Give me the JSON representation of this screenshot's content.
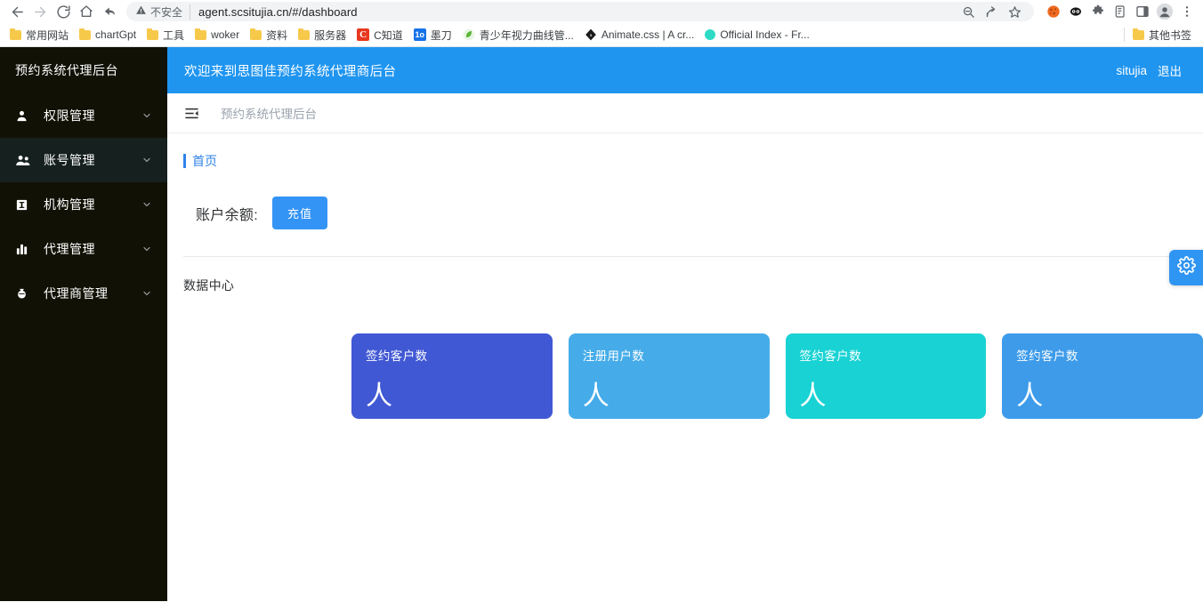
{
  "browser": {
    "nav": {
      "back": "back-arrow",
      "forward": "forward-arrow",
      "reload": "reload",
      "home": "home",
      "undo": "undo-arrow"
    },
    "omnibox": {
      "security_label": "不安全",
      "url": "agent.scsitujia.cn/#/dashboard",
      "zoom_icon": "zoom-out-icon",
      "share_icon": "share-icon",
      "bookmark_icon": "star-icon"
    },
    "extensions": [
      "cookie-icon",
      "panda-icon",
      "puzzle-icon",
      "reader-icon",
      "sidepanel-icon",
      "profile-icon",
      "menu-icon"
    ],
    "bookmarks": [
      {
        "label": "常用网站",
        "icon": "folder-icon"
      },
      {
        "label": "chartGpt",
        "icon": "folder-icon"
      },
      {
        "label": "工具",
        "icon": "folder-icon"
      },
      {
        "label": "woker",
        "icon": "folder-icon"
      },
      {
        "label": "资料",
        "icon": "folder-icon"
      },
      {
        "label": "服务器",
        "icon": "folder-icon"
      },
      {
        "label": "C知道",
        "icon": "c-icon"
      },
      {
        "label": "墨刀",
        "icon": "modao-icon"
      },
      {
        "label": "青少年视力曲线管...",
        "icon": "leaf-icon"
      },
      {
        "label": "Animate.css | A cr...",
        "icon": "diamond-icon"
      },
      {
        "label": "Official Index - Fr...",
        "icon": "dot-icon"
      }
    ],
    "other_bookmarks": {
      "label": "其他书签",
      "icon": "folder-icon"
    }
  },
  "sidebar": {
    "brand": "预约系统代理后台",
    "items": [
      {
        "label": "权限管理",
        "icon": "user-icon",
        "active": false
      },
      {
        "label": "账号管理",
        "icon": "users-icon",
        "active": true
      },
      {
        "label": "机构管理",
        "icon": "building-icon",
        "active": false
      },
      {
        "label": "代理管理",
        "icon": "bar-chart-icon",
        "active": false
      },
      {
        "label": "代理商管理",
        "icon": "agent-icon",
        "active": false
      }
    ]
  },
  "topbar": {
    "title": "欢迎来到思图佳预约系统代理商后台",
    "username": "situjia",
    "logout": "退出"
  },
  "breadcrumb": {
    "fold_icon": "fold-menu-icon",
    "text": "预约系统代理后台"
  },
  "page": {
    "tab": "首页",
    "balance_label": "账户余额:",
    "balance_value": "",
    "recharge_button": "充值",
    "section_title": "数据中心",
    "cards": [
      {
        "title": "签约客户数",
        "value": "人",
        "color": "#4158d4"
      },
      {
        "title": "注册用户数",
        "value": "人",
        "color": "#45ace9"
      },
      {
        "title": "签约客户数",
        "value": "人",
        "color": "#19d2d4"
      },
      {
        "title": "签约客户数",
        "value": "人",
        "color": "#3d9bea"
      }
    ],
    "settings_handle": "gear-icon"
  },
  "colors": {
    "accent": "#1f95f0",
    "sidebar_bg": "#111105",
    "sidebar_active": "#16211f",
    "link": "#2f82e8",
    "button": "#3494f5"
  }
}
